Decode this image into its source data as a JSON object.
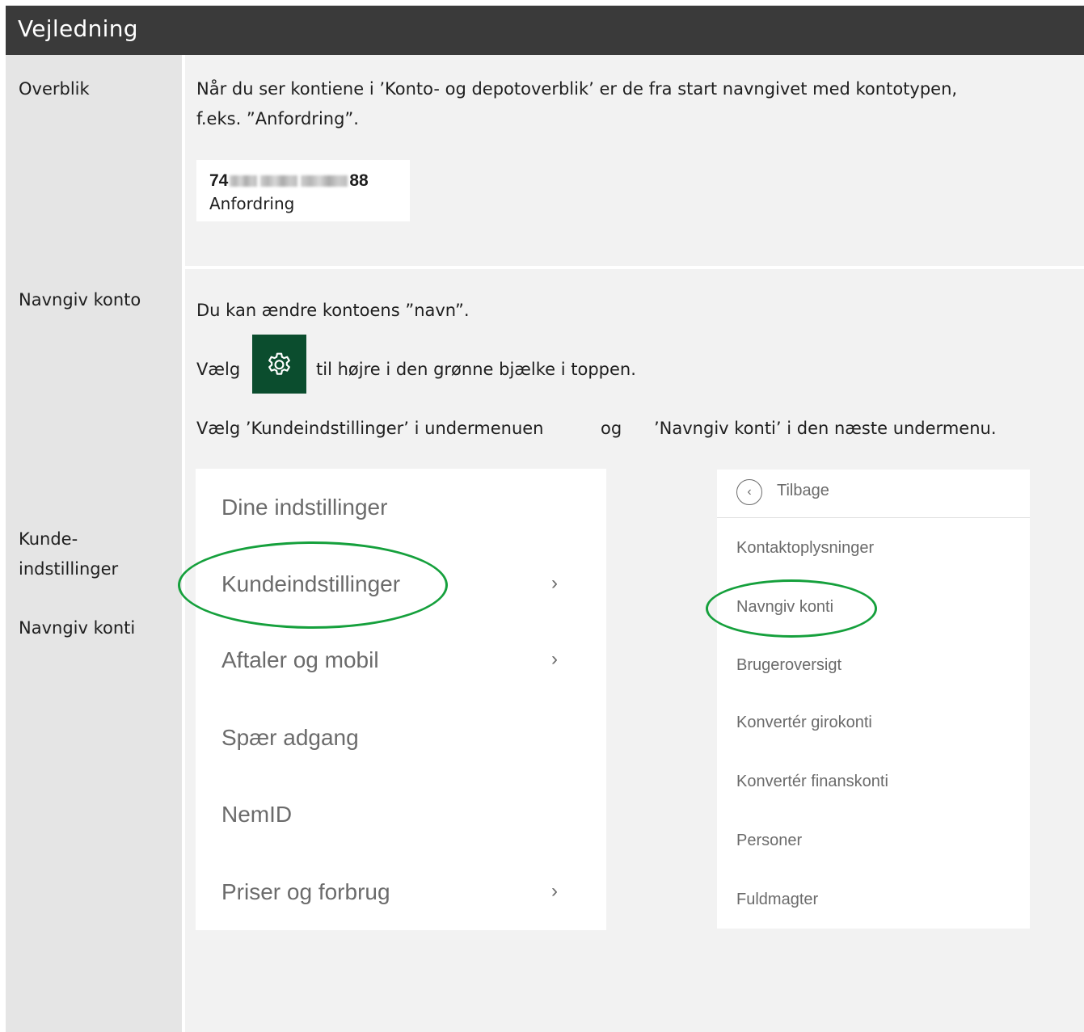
{
  "header": {
    "title": "Vejledning"
  },
  "sections": {
    "overblik": {
      "label": "Overblik",
      "text_line1": "Når du ser kontiene i ’Konto- og depotoverblik’ er de fra start navngivet med kontotypen,",
      "text_line2": "f.eks. ”Anfordring”.",
      "account": {
        "number_start": "74",
        "number_end": "88",
        "type": "Anfordring"
      }
    },
    "navngiv": {
      "label": "Navngiv konto",
      "text1": "Du kan ændre kontoens ”navn”.",
      "choose_prefix": "Vælg",
      "choose_suffix": "til højre i den grønne bjælke i toppen.",
      "gear_icon": "gear-icon",
      "submenu_text_a": "Vælg ’Kundeindstillinger’ i undermenuen",
      "submenu_text_og": "og",
      "submenu_text_b": "’Navngiv konti’ i den næste undermenu.",
      "label_kunde_1": "Kunde-",
      "label_kunde_2": "indstillinger",
      "label_konti": "Navngiv konti"
    }
  },
  "menu_left": {
    "items": [
      {
        "label": "Dine indstillinger",
        "chevron": ""
      },
      {
        "label": "Kundeindstillinger",
        "chevron": "›"
      },
      {
        "label": "Aftaler og mobil",
        "chevron": "›"
      },
      {
        "label": "Spær adgang",
        "chevron": ""
      },
      {
        "label": "NemID",
        "chevron": ""
      },
      {
        "label": "Priser og forbrug",
        "chevron": "›"
      }
    ]
  },
  "menu_right": {
    "back_label": "Tilbage",
    "back_glyph": "‹",
    "items": [
      "Kontaktoplysninger",
      "Navngiv konti",
      "Brugeroversigt",
      "Konvertér girokonti",
      "Konvertér finanskonti",
      "Personer",
      "Fuldmagter"
    ]
  },
  "colors": {
    "header_bg": "#3a3a3a",
    "gear_bg": "#0b4d2e",
    "highlight": "#15a03c"
  }
}
